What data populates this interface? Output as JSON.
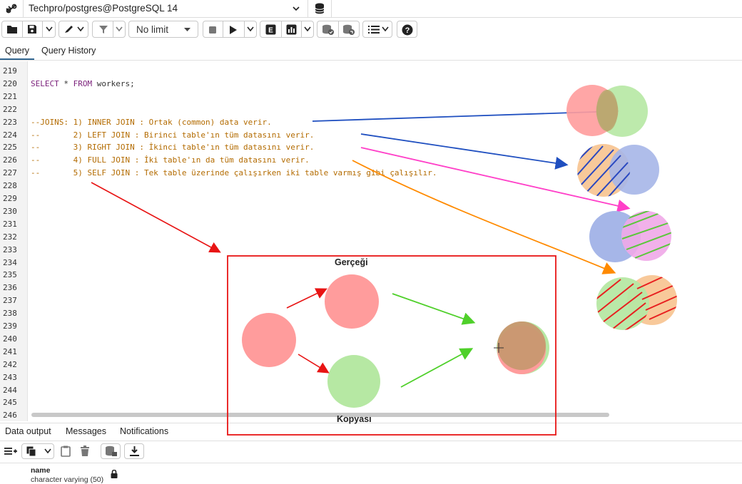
{
  "connection": {
    "title": "Techpro/postgres@PostgreSQL 14"
  },
  "toolbar": {
    "limit_label": "No limit"
  },
  "tabs": [
    "Query",
    "Query History"
  ],
  "editor": {
    "lines": [
      {
        "n": "219",
        "code": ""
      },
      {
        "n": "220",
        "code": "SELECT * FROM workers;"
      },
      {
        "n": "221",
        "code": ""
      },
      {
        "n": "222",
        "code": ""
      },
      {
        "n": "223",
        "code": "--JOINS: 1) INNER JOIN : Ortak (common) data verir."
      },
      {
        "n": "224",
        "code": "--       2) LEFT JOIN : Birinci table'ın tüm datasını verir."
      },
      {
        "n": "225",
        "code": "--       3) RIGHT JOIN : İkinci table'ın tüm datasını verir."
      },
      {
        "n": "226",
        "code": "--       4) FULL JOIN : İki table'ın da tüm datasını verir."
      },
      {
        "n": "227",
        "code": "--       5) SELF JOIN : Tek table üzerinde çalışırken iki table varmış gibi çalışılır."
      },
      {
        "n": "228",
        "code": ""
      },
      {
        "n": "229",
        "code": ""
      },
      {
        "n": "230",
        "code": ""
      },
      {
        "n": "231",
        "code": ""
      },
      {
        "n": "232",
        "code": ""
      },
      {
        "n": "233",
        "code": ""
      },
      {
        "n": "234",
        "code": ""
      },
      {
        "n": "235",
        "code": ""
      },
      {
        "n": "236",
        "code": ""
      },
      {
        "n": "237",
        "code": ""
      },
      {
        "n": "238",
        "code": ""
      },
      {
        "n": "239",
        "code": ""
      },
      {
        "n": "240",
        "code": ""
      },
      {
        "n": "241",
        "code": ""
      },
      {
        "n": "242",
        "code": ""
      },
      {
        "n": "243",
        "code": ""
      },
      {
        "n": "244",
        "code": ""
      },
      {
        "n": "245",
        "code": ""
      },
      {
        "n": "246",
        "code": ""
      }
    ]
  },
  "bottom_tabs": [
    "Data output",
    "Messages",
    "Notifications"
  ],
  "result": {
    "column_name": "name",
    "column_type": "character varying (50)"
  },
  "annotation": {
    "box_top_label": "Gerçeği",
    "box_bottom_label": "Kopyası"
  },
  "colors": {
    "accent": "#326690",
    "red_circle": "#ff9c9c",
    "green_circle": "#b6e8a3",
    "orange_circle": "#f8c99a",
    "blue_circle": "#a6b6e8",
    "pink_circle": "#f0a8e8"
  }
}
